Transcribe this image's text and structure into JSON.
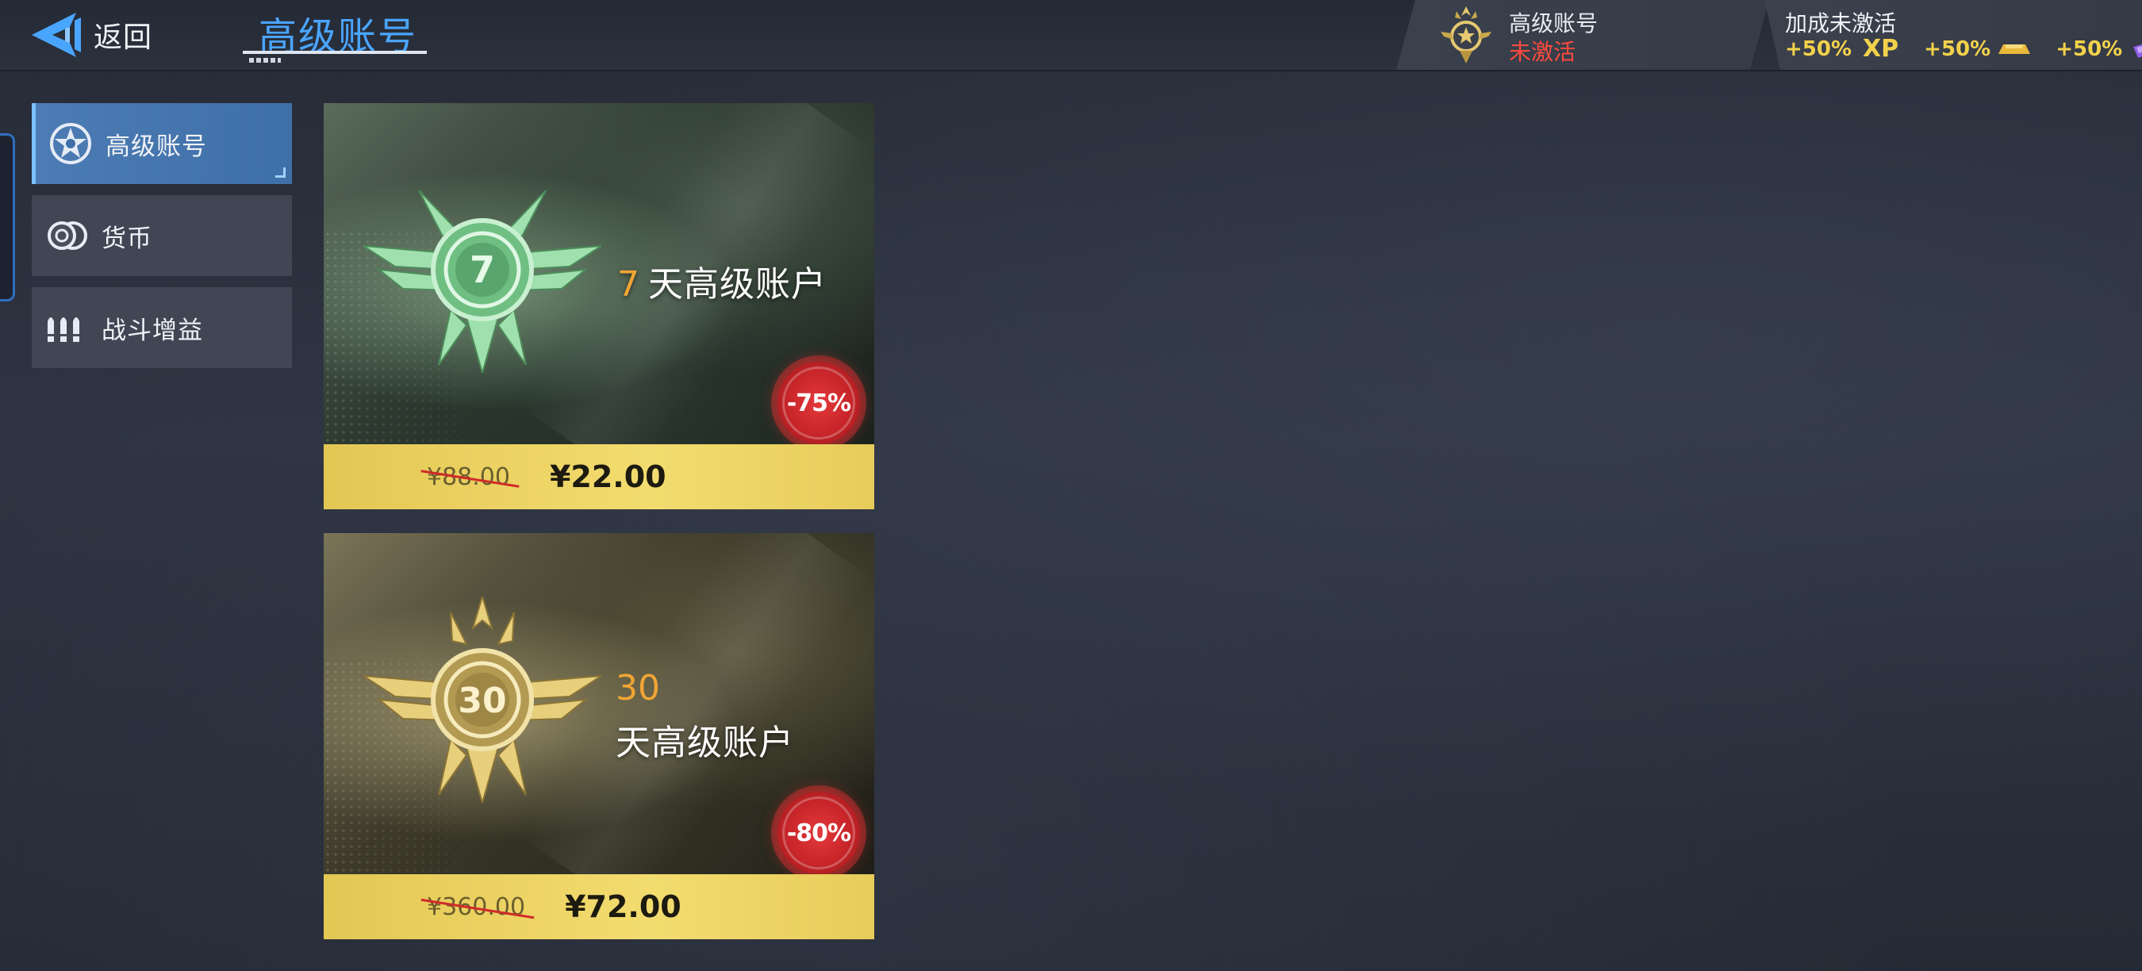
{
  "header": {
    "back_label": "返回",
    "page_title": "高级账号"
  },
  "status": {
    "title": "高级账号",
    "state": "未激活",
    "state_color": "#ff4a3d"
  },
  "bonus": {
    "title": "加成未激活",
    "xp_bonus": "+50%",
    "xp_label": "XP",
    "gold_bonus": "+50%",
    "ticket_bonus": "+50%"
  },
  "sidebar": {
    "items": [
      {
        "label": "高级账号",
        "icon": "premium-star-icon",
        "active": true
      },
      {
        "label": "货币",
        "icon": "coins-icon",
        "active": false
      },
      {
        "label": "战斗增益",
        "icon": "ammo-icon",
        "active": false
      }
    ]
  },
  "offers": [
    {
      "days": "7",
      "label": "天高级账户",
      "discount": "-75%",
      "old_price": "¥88.00",
      "price": "¥22.00",
      "accent": "#8fd9a0"
    },
    {
      "days": "30",
      "label": "天高级账户",
      "discount": "-80%",
      "old_price": "¥360.00",
      "price": "¥72.00",
      "accent": "#e8cf7c"
    }
  ],
  "colors": {
    "accent_blue": "#4aa5ff",
    "price_bar": "#f0d766",
    "discount_red": "#d63034",
    "days_orange": "#f2a534",
    "bonus_gold": "#f3d24b"
  }
}
